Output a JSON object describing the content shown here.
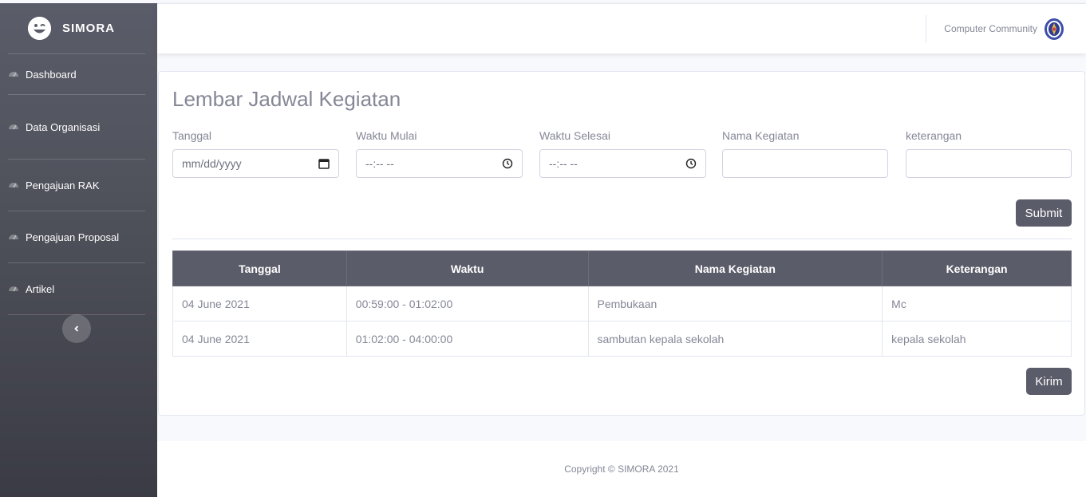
{
  "brand": {
    "name": "SIMORA"
  },
  "sidebar": {
    "items": [
      {
        "label": "Dashboard",
        "icon": "tachometer-icon"
      },
      {
        "label": "Data Organisasi",
        "icon": "tachometer-icon"
      },
      {
        "label": "Pengajuan RAK",
        "icon": "tachometer-icon"
      },
      {
        "label": "Pengajuan Proposal",
        "icon": "tachometer-icon"
      },
      {
        "label": "Artikel",
        "icon": "tachometer-icon"
      }
    ],
    "toggle_icon": "chevron-left-icon"
  },
  "topbar": {
    "user_name": "Computer Community"
  },
  "form": {
    "title": "Lembar Jadwal Kegiatan",
    "fields": {
      "tanggal": {
        "label": "Tanggal",
        "placeholder": "mm/dd/yyyy"
      },
      "waktu_mulai": {
        "label": "Waktu Mulai",
        "placeholder": "--:-- --"
      },
      "waktu_selesai": {
        "label": "Waktu Selesai",
        "placeholder": "--:-- --"
      },
      "nama_kegiatan": {
        "label": "Nama Kegiatan",
        "value": ""
      },
      "keterangan": {
        "label": "keterangan",
        "value": ""
      }
    },
    "submit_label": "Submit"
  },
  "table": {
    "headers": [
      "Tanggal",
      "Waktu",
      "Nama Kegiatan",
      "Keterangan"
    ],
    "rows": [
      [
        "04 June 2021",
        "00:59:00 - 01:02:00",
        "Pembukaan",
        "Mc"
      ],
      [
        "04 June 2021",
        "01:02:00 - 04:00:00",
        "sambutan kepala sekolah",
        "kepala sekolah"
      ]
    ]
  },
  "send_label": "Kirim",
  "footer": {
    "copyright": "Copyright © SIMORA 2021"
  },
  "colors": {
    "primary": "#5a5c69",
    "text": "#858796",
    "border": "#e3e6f0"
  }
}
